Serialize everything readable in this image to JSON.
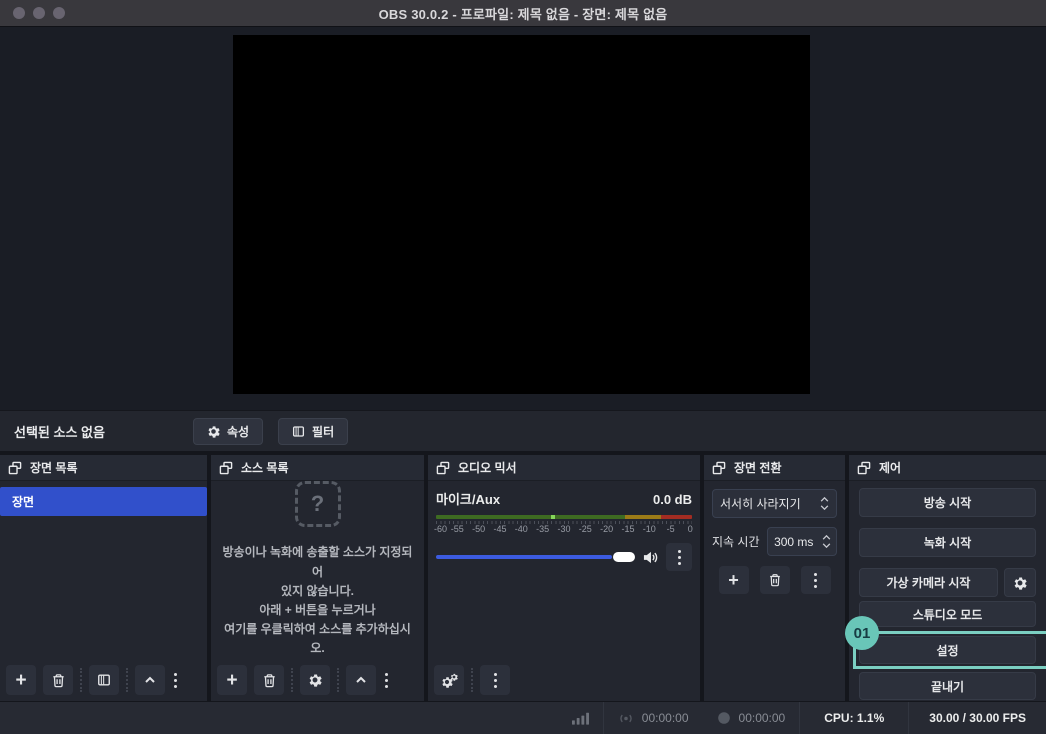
{
  "window": {
    "title": "OBS 30.0.2 - 프로파일: 제목 없음 - 장면: 제목 없음"
  },
  "context_bar": {
    "no_source": "선택된 소스 없음",
    "properties": "속성",
    "filters": "필터"
  },
  "icons": {
    "plus": "+",
    "names": [
      "popout-icon",
      "gear-icon",
      "trash-icon",
      "filter-icon",
      "chevron-up-icon",
      "kebab-menu-icon",
      "speaker-icon",
      "signal-bars-icon",
      "broadcast-icon",
      "record-icon",
      "question-box-icon"
    ]
  },
  "panels": {
    "scenes": {
      "title": "장면 목록",
      "selected_scene": "장면"
    },
    "sources": {
      "title": "소스 목록",
      "empty_icon": "?",
      "empty_lines": [
        "방송이나 녹화에 송출할 소스가 지정되어",
        "있지 않습니다.",
        "아래 + 버튼을 누르거나",
        "여기를 우클릭하여 소스를 추가하십시오."
      ]
    },
    "mixer": {
      "title": "오디오 믹서",
      "channel_name": "마이크/Aux",
      "level": "0.0 dB",
      "ticks": [
        "-60",
        "-55",
        "-50",
        "-45",
        "-40",
        "-35",
        "-30",
        "-25",
        "-20",
        "-15",
        "-10",
        "-5",
        "0"
      ],
      "volume_percent": 100
    },
    "transitions": {
      "title": "장면 전환",
      "selected_transition": "서서히 사라지기",
      "duration_label": "지속 시간",
      "duration_value": "300 ms"
    },
    "controls": {
      "title": "제어",
      "start_streaming": "방송 시작",
      "start_recording": "녹화 시작",
      "start_virtual_camera": "가상 카메라 시작",
      "studio_mode": "스튜디오 모드",
      "settings": "설정",
      "exit": "끝내기"
    }
  },
  "annotation": {
    "badge": "01",
    "color": "#6fc8ba"
  },
  "status_bar": {
    "stream_time": "00:00:00",
    "record_time": "00:00:00",
    "cpu": "CPU: 1.1%",
    "fps": "30.00 / 30.00 FPS"
  },
  "colors": {
    "accent_blue": "#3150cb",
    "slider_blue": "#3c5be0",
    "annotation_teal": "#6fc8ba",
    "meter_green": "#3e6b22",
    "meter_yellow": "#9c7b17",
    "meter_red": "#a32c22",
    "panel_bg": "#23262f",
    "titlebar_bg": "#39383d"
  }
}
